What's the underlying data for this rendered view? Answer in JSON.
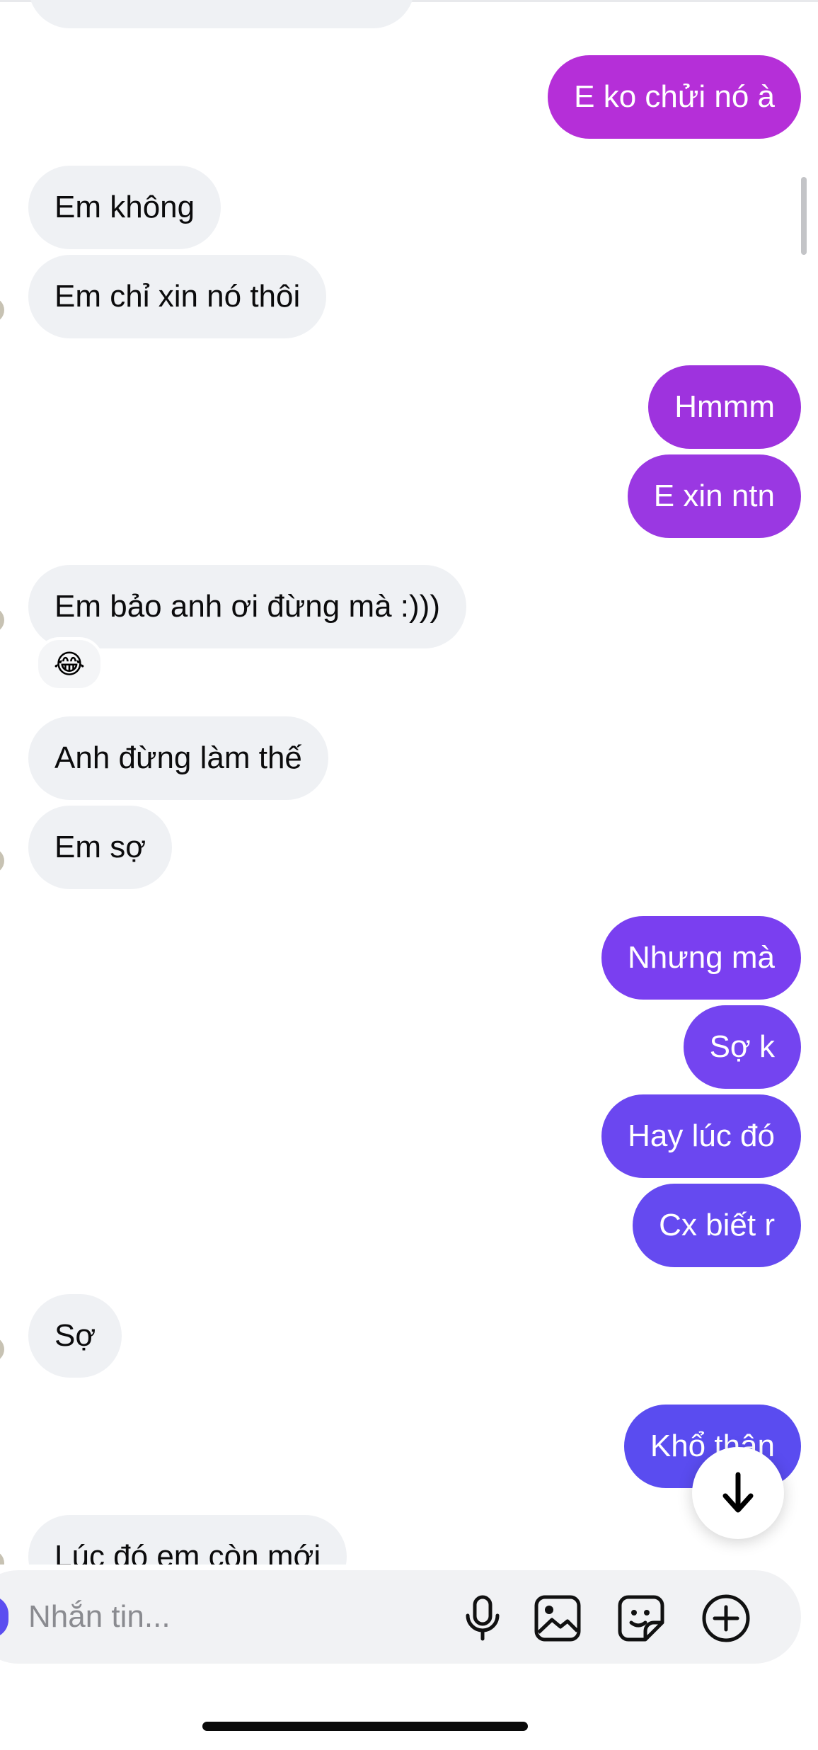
{
  "colors": {
    "incoming_bg": "#eff1f4",
    "outgoing_top": "#b52fd8",
    "outgoing_mid": "#7a3ff0",
    "outgoing_bottom": "#5a4cf0"
  },
  "messages": [
    {
      "id": "m1",
      "side": "out",
      "text": "E ko chửi nó à"
    },
    {
      "id": "m2",
      "side": "in",
      "text": "Em không"
    },
    {
      "id": "m3",
      "side": "in",
      "text": "Em chỉ xin nó thôi"
    },
    {
      "id": "m4",
      "side": "out",
      "text": "Hmmm"
    },
    {
      "id": "m5",
      "side": "out",
      "text": "E xin ntn"
    },
    {
      "id": "m6",
      "side": "in",
      "text": "Em bảo anh ơi đừng mà :)))",
      "reaction": "😂"
    },
    {
      "id": "m7",
      "side": "in",
      "text": "Anh đừng làm thế"
    },
    {
      "id": "m8",
      "side": "in",
      "text": "Em sợ"
    },
    {
      "id": "m9",
      "side": "out",
      "text": "Nhưng mà"
    },
    {
      "id": "m10",
      "side": "out",
      "text": "Sợ k"
    },
    {
      "id": "m11",
      "side": "out",
      "text": "Hay lúc đó"
    },
    {
      "id": "m12",
      "side": "out",
      "text": "Cx biết r"
    },
    {
      "id": "m13",
      "side": "in",
      "text": "Sợ"
    },
    {
      "id": "m14",
      "side": "out",
      "text": "Khổ thân"
    },
    {
      "id": "m15",
      "side": "in",
      "text": "Lúc đó em còn mới"
    }
  ],
  "composer": {
    "placeholder": "Nhắn tin...",
    "icons": [
      "microphone-icon",
      "image-icon",
      "sticker-icon",
      "plus-circle-icon"
    ]
  },
  "scroll_button_icon": "arrow-down-icon"
}
